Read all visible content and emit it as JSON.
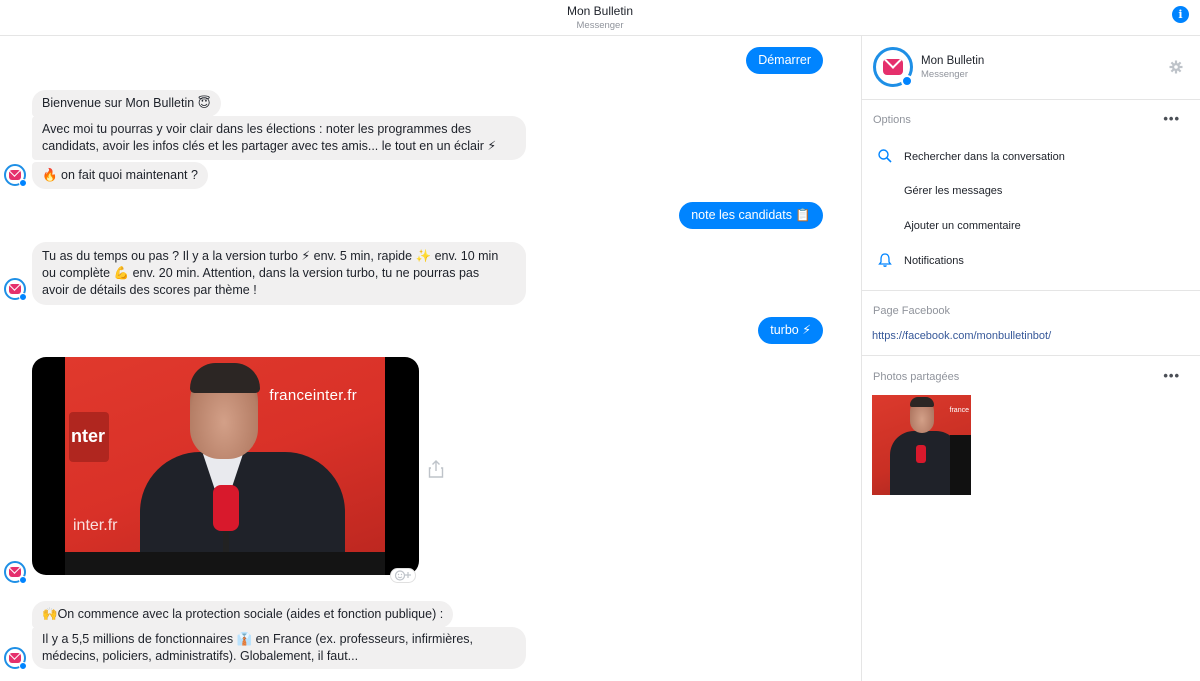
{
  "header": {
    "title": "Mon Bulletin",
    "subtitle": "Messenger",
    "info_icon": "i"
  },
  "chat": {
    "messages": {
      "m1": "Démarrer",
      "m2": "Bienvenue sur Mon Bulletin 😇",
      "m3a": "Avec moi tu pourras y voir clair dans les élections : noter les programmes des",
      "m3b": "candidats, avoir les infos clés et les partager avec tes amis... le tout en un éclair ⚡",
      "m4": "🔥 on fait quoi maintenant ?",
      "m5": "note les candidats 📋",
      "m6a": "Tu as du temps ou pas ? Il y a la version turbo ⚡ env. 5 min, rapide ✨ env. 10 min",
      "m6b": "ou complète 💪 env. 20 min. Attention, dans la version turbo, tu ne pourras pas",
      "m6c": "avoir de détails des scores par thème !",
      "m7": "turbo ⚡",
      "m8": "🙌On commence avec la protection sociale (aides et fonction publique) :",
      "m9a": "Il y a 5,5 millions de fonctionnaires 👔 en France (ex. professeurs, infirmières,",
      "m9b": "médecins, policiers, administratifs). Globalement, il faut..."
    },
    "video": {
      "logo_text": "franceinter.fr",
      "logo_text_partial": "inter.fr",
      "logo_mark": "nter",
      "mic_label": "inter"
    }
  },
  "panel": {
    "name": "Mon Bulletin",
    "subtitle": "Messenger",
    "options_title": "Options",
    "options": [
      "Rechercher dans la conversation",
      "Gérer les messages",
      "Ajouter un commentaire",
      "Notifications"
    ],
    "facebook_title": "Page Facebook",
    "facebook_link": "https://facebook.com/monbulletinbot/",
    "photos_title": "Photos partagées",
    "more": "•••",
    "thumb_logo": "france"
  },
  "colors": {
    "accent": "#0084ff",
    "incoming_bubble": "#f1f0f0",
    "brand_pink": "#e5306c",
    "link": "#365899"
  }
}
